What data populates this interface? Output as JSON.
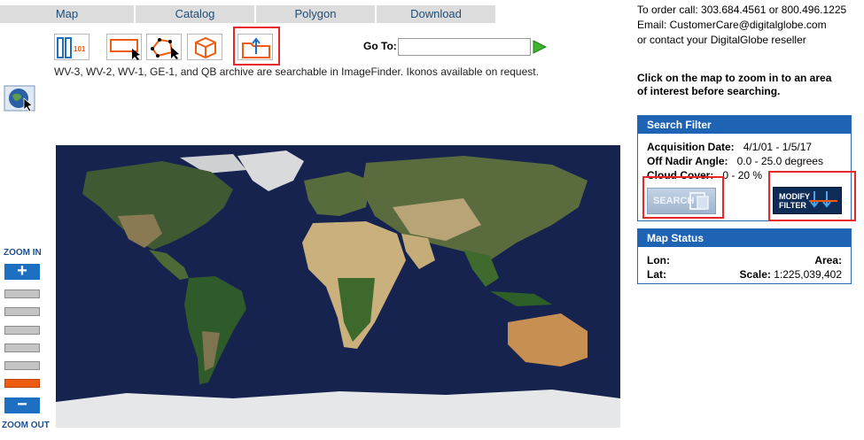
{
  "tabs": [
    "Map",
    "Catalog",
    "Polygon",
    "Download"
  ],
  "tools": [
    {
      "icon": "strip-id-icon",
      "text": "101"
    },
    {
      "icon": "rectangle-select-icon"
    },
    {
      "icon": "polygon-select-icon"
    },
    {
      "icon": "cube-icon"
    },
    {
      "icon": "upload-shape-icon"
    }
  ],
  "goto": {
    "label": "Go To:",
    "value": "",
    "placeholder": ""
  },
  "archive_note": "WV-3, WV-2, WV-1, GE-1, and QB archive are searchable in ImageFinder. Ikonos available on request.",
  "contact": {
    "line1": "To order call: 303.684.4561 or 800.496.1225",
    "line2": "Email: CustomerCare@digitalglobe.com",
    "line3": "or contact your DigitalGlobe reseller"
  },
  "click_hint": "Click on the map to zoom in to an area of interest before searching.",
  "search_filter": {
    "title": "Search Filter",
    "acq_label": "Acquisition Date:",
    "acq_value": "4/1/01 - 1/5/17",
    "nadir_label": "Off Nadir Angle:",
    "nadir_value": "0.0 - 25.0 degrees",
    "cloud_label": "Cloud Cover:",
    "cloud_value": "0 - 20 %",
    "search_label": "SEARCH",
    "modify_label_1": "MODIFY",
    "modify_label_2": "FILTER"
  },
  "map_status": {
    "title": "Map Status",
    "lon_label": "Lon:",
    "area_label": "Area:",
    "lat_label": "Lat:",
    "scale_label": "Scale:",
    "scale_value": "1:225,039,402"
  },
  "zoom": {
    "in_label": "ZOOM IN",
    "out_label": "ZOOM OUT",
    "levels": 6,
    "active_level": 6
  },
  "colors": {
    "accent": "#1f63b5",
    "highlight": "#e8262b",
    "zoom_active": "#ee5c12",
    "tab_text": "#1f4e79"
  }
}
